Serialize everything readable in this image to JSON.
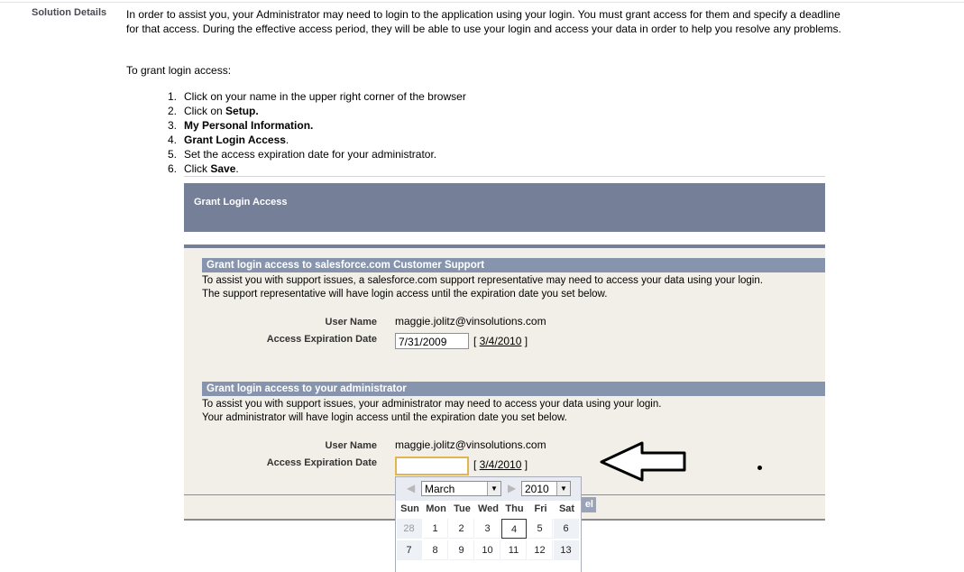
{
  "solution": {
    "label": "Solution Details",
    "intro": "In order to assist you, your Administrator  may need to login to the application using your login. You must grant access for them and specify a deadline for that access. During the effective access period, they will be able to use your login and access your data in order to help you resolve any problems.",
    "grant_intro": "To grant login access:",
    "steps": [
      {
        "num": "1.",
        "pre": "Click on your name in the upper right corner of the browser",
        "bold": "",
        "post": ""
      },
      {
        "num": "2.",
        "pre": "Click on ",
        "bold": "Setup.",
        "post": ""
      },
      {
        "num": "3.",
        "pre": "",
        "bold": "My Personal Information.",
        "post": ""
      },
      {
        "num": "4.",
        "pre": "",
        "bold": "Grant Login Access",
        "post": "."
      },
      {
        "num": "5.",
        "pre": "Set the access expiration date for your administrator.",
        "bold": "",
        "post": ""
      },
      {
        "num": "6.",
        "pre": "Click ",
        "bold": "Save",
        "post": "."
      }
    ]
  },
  "grant_page": {
    "title": "Grant Login Access",
    "support_section": {
      "heading": "Grant login access to salesforce.com Customer Support",
      "line1": "To assist you with support issues, a salesforce.com support representative may need to access your data using your login.",
      "line2": "The support representative will have login access until the expiration date you set below.",
      "user_name_label": "User Name",
      "user_name_value": "maggie.jolitz@vinsolutions.com",
      "expiration_label": "Access Expiration Date",
      "expiration_value": "7/31/2009",
      "date_link": "3/4/2010"
    },
    "admin_section": {
      "heading": "Grant login access to your administrator",
      "line1": "To assist you with support issues, your administrator may need to access your data using your login.",
      "line2": "Your administrator will have login access until the expiration date you set below.",
      "user_name_label": "User Name",
      "user_name_value": "maggie.jolitz@vinsolutions.com",
      "expiration_label": "Access Expiration Date",
      "expiration_value": "",
      "date_link": "3/4/2010"
    },
    "button_fragment": "el"
  },
  "calendar": {
    "month": "March",
    "year": "2010",
    "days_of_week": [
      "Sun",
      "Mon",
      "Tue",
      "Wed",
      "Thu",
      "Fri",
      "Sat"
    ],
    "week1": [
      "28",
      "1",
      "2",
      "3",
      "4",
      "5",
      "6"
    ],
    "week2": [
      "7",
      "8",
      "9",
      "10",
      "11",
      "12",
      "13"
    ],
    "today": "4"
  }
}
